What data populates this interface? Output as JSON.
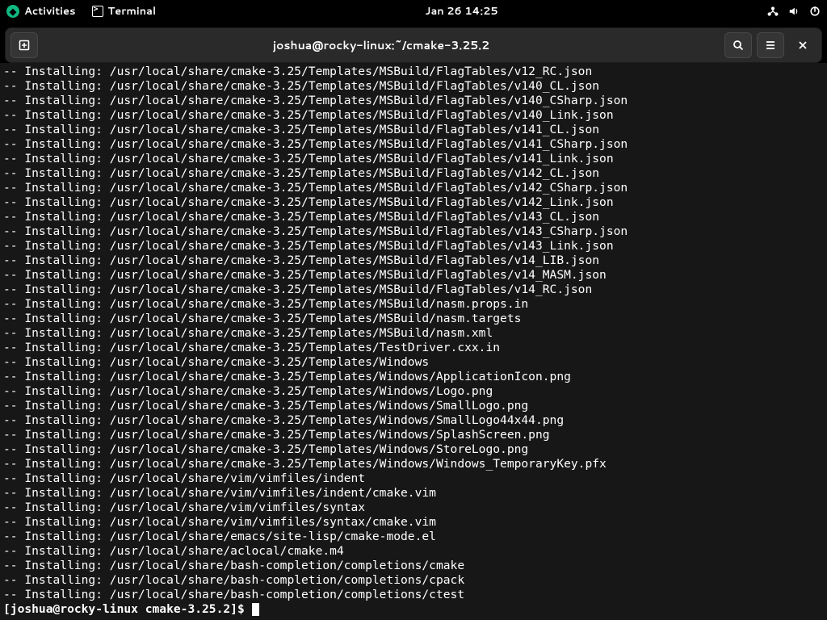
{
  "topbar": {
    "activities": "Activities",
    "app": "Terminal",
    "clock": "Jan 26  14:25"
  },
  "headerbar": {
    "title": "joshua@rocky-linux:~/cmake-3.25.2"
  },
  "terminal": {
    "prefix": "-- Installing: ",
    "base": "/usr/local/share/",
    "lines": [
      "cmake-3.25/Templates/MSBuild/FlagTables/v12_RC.json",
      "cmake-3.25/Templates/MSBuild/FlagTables/v140_CL.json",
      "cmake-3.25/Templates/MSBuild/FlagTables/v140_CSharp.json",
      "cmake-3.25/Templates/MSBuild/FlagTables/v140_Link.json",
      "cmake-3.25/Templates/MSBuild/FlagTables/v141_CL.json",
      "cmake-3.25/Templates/MSBuild/FlagTables/v141_CSharp.json",
      "cmake-3.25/Templates/MSBuild/FlagTables/v141_Link.json",
      "cmake-3.25/Templates/MSBuild/FlagTables/v142_CL.json",
      "cmake-3.25/Templates/MSBuild/FlagTables/v142_CSharp.json",
      "cmake-3.25/Templates/MSBuild/FlagTables/v142_Link.json",
      "cmake-3.25/Templates/MSBuild/FlagTables/v143_CL.json",
      "cmake-3.25/Templates/MSBuild/FlagTables/v143_CSharp.json",
      "cmake-3.25/Templates/MSBuild/FlagTables/v143_Link.json",
      "cmake-3.25/Templates/MSBuild/FlagTables/v14_LIB.json",
      "cmake-3.25/Templates/MSBuild/FlagTables/v14_MASM.json",
      "cmake-3.25/Templates/MSBuild/FlagTables/v14_RC.json",
      "cmake-3.25/Templates/MSBuild/nasm.props.in",
      "cmake-3.25/Templates/MSBuild/nasm.targets",
      "cmake-3.25/Templates/MSBuild/nasm.xml",
      "cmake-3.25/Templates/TestDriver.cxx.in",
      "cmake-3.25/Templates/Windows",
      "cmake-3.25/Templates/Windows/ApplicationIcon.png",
      "cmake-3.25/Templates/Windows/Logo.png",
      "cmake-3.25/Templates/Windows/SmallLogo.png",
      "cmake-3.25/Templates/Windows/SmallLogo44x44.png",
      "cmake-3.25/Templates/Windows/SplashScreen.png",
      "cmake-3.25/Templates/Windows/StoreLogo.png",
      "cmake-3.25/Templates/Windows/Windows_TemporaryKey.pfx",
      "vim/vimfiles/indent",
      "vim/vimfiles/indent/cmake.vim",
      "vim/vimfiles/syntax",
      "vim/vimfiles/syntax/cmake.vim",
      "emacs/site-lisp/cmake-mode.el",
      "aclocal/cmake.m4",
      "bash-completion/completions/cmake",
      "bash-completion/completions/cpack",
      "bash-completion/completions/ctest"
    ],
    "prompt": "[joshua@rocky-linux cmake-3.25.2]$ "
  }
}
